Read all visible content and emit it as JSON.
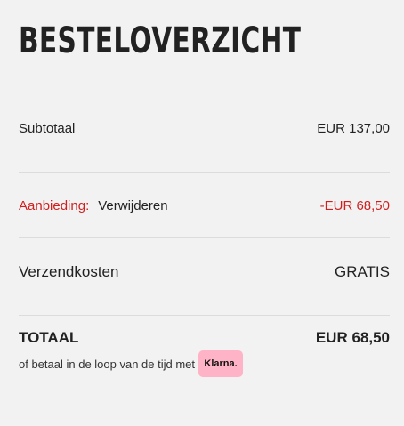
{
  "header": {
    "title": "BESTELOVERZICHT"
  },
  "summary": {
    "subtotal_label": "Subtotaal",
    "subtotal_value": "EUR 137,00",
    "discount_label": "Aanbieding:",
    "discount_remove": "Verwijderen",
    "discount_value": "-EUR 68,50",
    "shipping_label": "Verzendkosten",
    "shipping_value": "GRATIS",
    "total_label": "TOTAAL",
    "total_value": "EUR 68,50"
  },
  "payment": {
    "pay_later_text": "of betaal in de loop van de tijd met",
    "klarna_label": "Klarna."
  },
  "colors": {
    "background": "#f2f2f2",
    "discount_red": "#d01f1f",
    "klarna_pink": "#ffb3c7",
    "divider": "#dcdcdc"
  }
}
